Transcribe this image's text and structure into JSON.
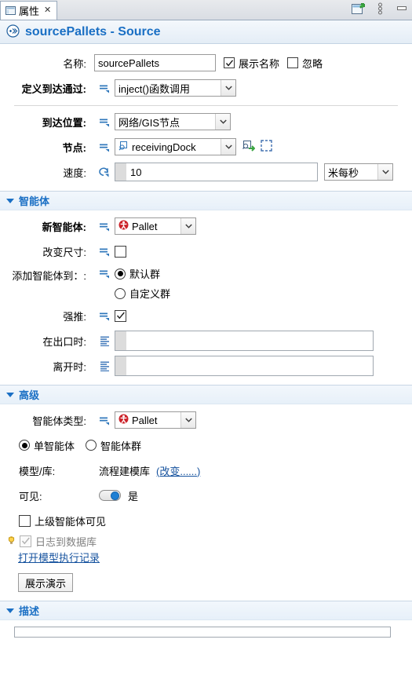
{
  "tab": {
    "label": "属性",
    "icon": "properties-icon",
    "close": "✕"
  },
  "tabtools": {
    "pin_icon": "new-window-icon",
    "menu_icon": "view-menu-icon",
    "minimize_icon": "minimize-icon"
  },
  "header": {
    "title": "sourcePallets - Source",
    "icon": "source-icon",
    "accent": "#1a6fc4"
  },
  "main": {
    "name": {
      "label": "名称:",
      "value": "sourcePallets"
    },
    "show_name": {
      "label": "展示名称",
      "checked": true
    },
    "ignore": {
      "label": "忽略",
      "checked": false
    },
    "arrivals_defined_by": {
      "label": "定义到达通过:",
      "value": "inject()函数调用"
    },
    "arrival_location": {
      "label": "到达位置:",
      "value": "网络/GIS节点"
    },
    "node": {
      "label": "节点:",
      "value": "receivingDock",
      "icon": "node-marker-icon",
      "tool1_icon": "go-to-icon",
      "tool2_icon": "select-on-canvas-icon"
    },
    "speed": {
      "label": "速度:",
      "value": "10",
      "unit": "米每秒",
      "icon": "reset-icon"
    }
  },
  "agent_section": {
    "title": "智能体",
    "new_agent": {
      "label": "新智能体:",
      "value": "Pallet",
      "icon": "agent-icon",
      "color": "#cc2229"
    },
    "change_dimensions": {
      "label": "改变尺寸:",
      "checked": false
    },
    "add_agents_to": {
      "label": "添加智能体到：:",
      "options": [
        {
          "label": "默认群",
          "selected": true
        },
        {
          "label": "自定义群",
          "selected": false
        }
      ]
    },
    "push_protocol": {
      "label": "强推:",
      "checked": true
    },
    "on_exit": {
      "label": "在出口时:",
      "value": "",
      "icon": "code-icon"
    },
    "on_at_exit": {
      "label": "离开时:",
      "value": "",
      "icon": "code-icon"
    }
  },
  "advanced_section": {
    "title": "高级",
    "agent_type": {
      "label": "智能体类型:",
      "value": "Pallet",
      "icon": "agent-icon",
      "color": "#cc2229"
    },
    "scope": {
      "options": [
        {
          "label": "单智能体",
          "selected": true
        },
        {
          "label": "智能体群",
          "selected": false
        }
      ]
    },
    "model_library": {
      "label": "模型/库:",
      "value": "流程建模库",
      "change_link": "(改变......)"
    },
    "visible": {
      "label": "可见:",
      "value": "是",
      "on": true
    },
    "visible_on_upper": {
      "label": "上级智能体可见",
      "checked": false
    },
    "log_to_database": {
      "label": "日志到数据库",
      "checked": true,
      "disabled": true,
      "hint_icon": "lightbulb-icon"
    },
    "open_log_link": "打开模型执行记录",
    "show_presentation_button": "展示演示"
  },
  "description_section": {
    "title": "描述"
  }
}
